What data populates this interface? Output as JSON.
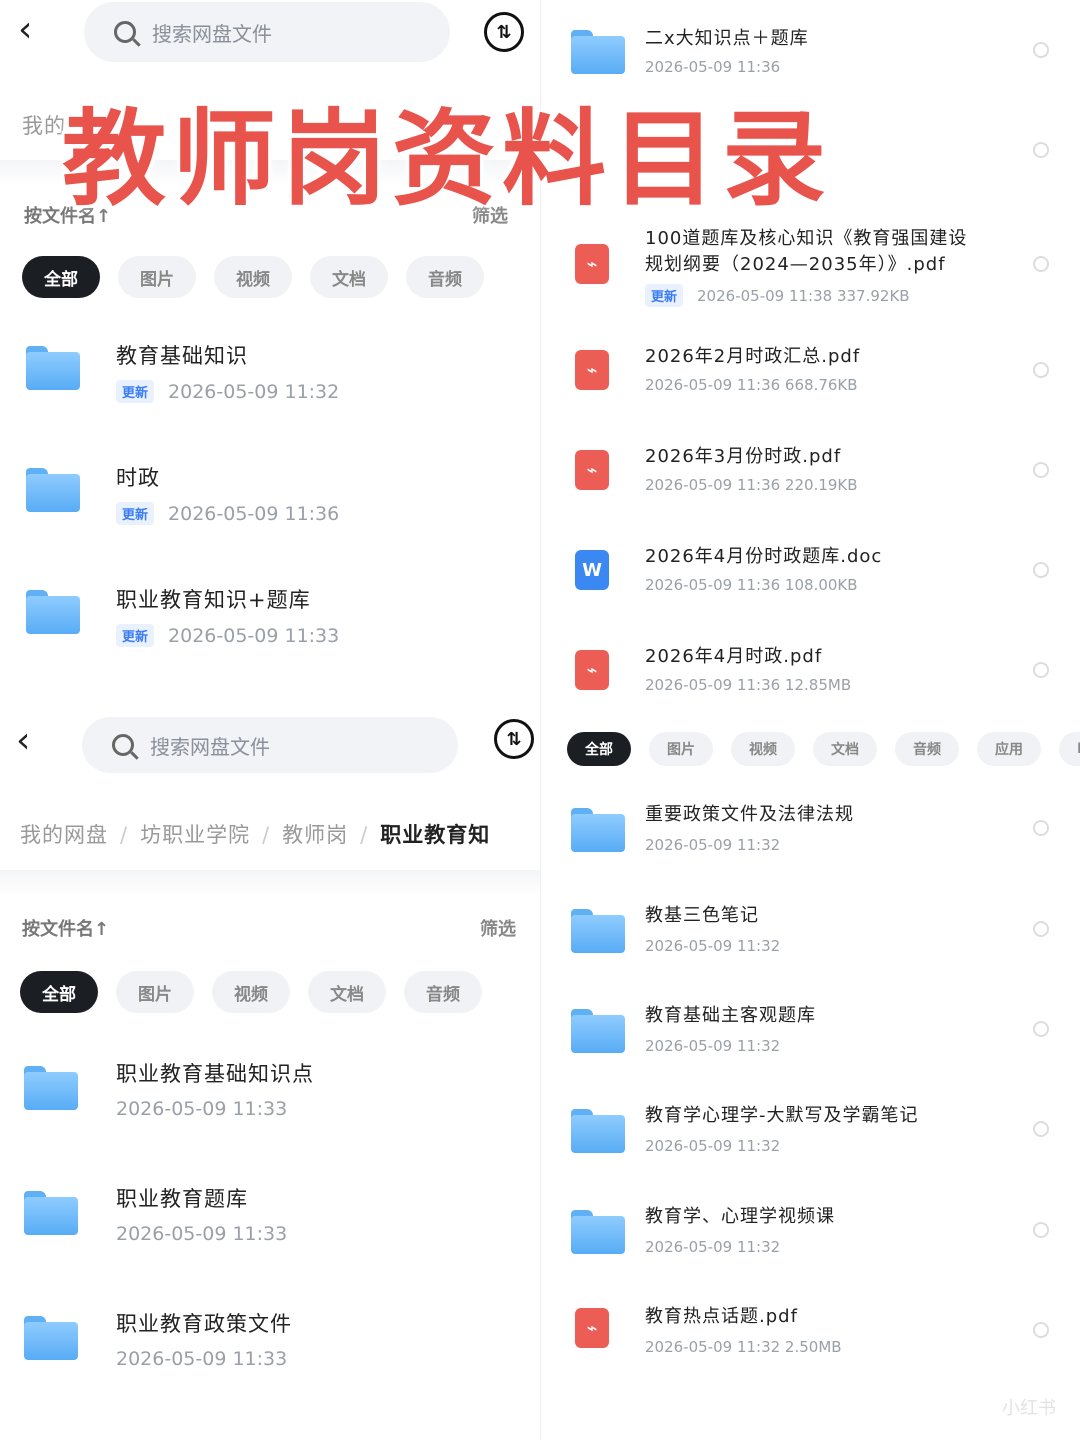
{
  "overlay_title": "教师岗资料目录",
  "top_left": {
    "search_placeholder": "搜索网盘文件",
    "sort_icon_label": "⇅",
    "crumb_partial": "我的",
    "sort_label": "按文件名↑",
    "filter_label": "筛选",
    "chips": [
      "全部",
      "图片",
      "视频",
      "文档",
      "音频"
    ],
    "files": [
      {
        "name": "教育基础知识",
        "badge": "更新",
        "time": "2026-05-09  11:32"
      },
      {
        "name": "时政",
        "badge": "更新",
        "time": "2026-05-09  11:36"
      },
      {
        "name": "职业教育知识+题库",
        "badge": "更新",
        "time": "2026-05-09  11:33"
      }
    ]
  },
  "bottom_left": {
    "search_placeholder": "搜索网盘文件",
    "sort_icon_label": "⇅",
    "crumbs": [
      "我的网盘",
      "坊职业学院",
      "教师岗",
      "职业教育知"
    ],
    "sort_label": "按文件名↑",
    "filter_label": "筛选",
    "chips": [
      "全部",
      "图片",
      "视频",
      "文档",
      "音频"
    ],
    "files": [
      {
        "name": "职业教育基础知识点",
        "time": "2026-05-09  11:33"
      },
      {
        "name": "职业教育题库",
        "time": "2026-05-09  11:33"
      },
      {
        "name": "职业教育政策文件",
        "time": "2026-05-09  11:33"
      }
    ]
  },
  "top_right": {
    "files": [
      {
        "type": "folder",
        "name": "二x大知识点＋题库",
        "time": "2026-05-09  11:36"
      },
      {
        "type": "pdf",
        "name": "100道题库及核心知识《教育强国建设",
        "name2": "规划纲要（2024—2035年）》.pdf",
        "badge": "更新",
        "time": "2026-05-09  11:38  337.92KB"
      },
      {
        "type": "pdf",
        "name": "2026年2月时政汇总.pdf",
        "time": "2026-05-09  11:36  668.76KB"
      },
      {
        "type": "pdf",
        "name": "2026年3月份时政.pdf",
        "time": "2026-05-09  11:36  220.19KB"
      },
      {
        "type": "doc",
        "name": "2026年4月份时政题库.doc",
        "time": "2026-05-09  11:36  108.00KB"
      },
      {
        "type": "pdf",
        "name": "2026年4月时政.pdf",
        "time": "2026-05-09  11:36  12.85MB"
      }
    ]
  },
  "bottom_right": {
    "chips": [
      "全部",
      "图片",
      "视频",
      "文档",
      "音频",
      "应用",
      "BT"
    ],
    "files": [
      {
        "type": "folder",
        "name": "重要政策文件及法律法规",
        "time": "2026-05-09  11:32"
      },
      {
        "type": "folder",
        "name": "教基三色笔记",
        "time": "2026-05-09  11:32"
      },
      {
        "type": "folder",
        "name": "教育基础主客观题库",
        "time": "2026-05-09  11:32"
      },
      {
        "type": "folder",
        "name": "教育学心理学-大默写及学霸笔记",
        "time": "2026-05-09  11:32"
      },
      {
        "type": "folder",
        "name": "教育学、心理学视频课",
        "time": "2026-05-09  11:32"
      },
      {
        "type": "pdf",
        "name": "教育热点话题.pdf",
        "time": "2026-05-09  11:32  2.50MB"
      }
    ]
  },
  "watermark": "小红书"
}
